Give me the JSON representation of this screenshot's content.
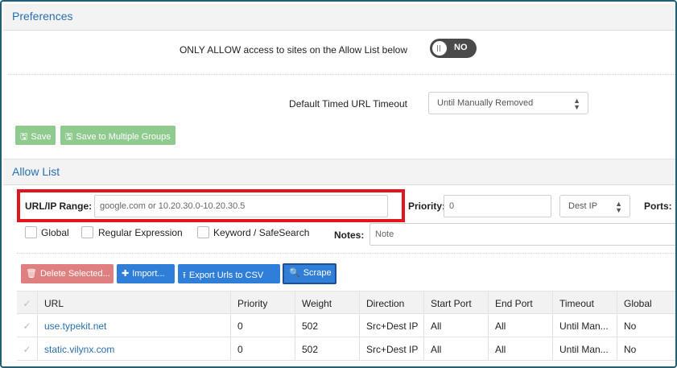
{
  "preferences": {
    "title": "Preferences",
    "only_allow_label": "ONLY ALLOW access to sites on the Allow List below",
    "toggle_text": "NO",
    "timeout_label": "Default Timed URL Timeout",
    "timeout_value": "Until Manually Removed",
    "save_label": "Save",
    "save_multi_label": "Save to Multiple Groups"
  },
  "allow_list": {
    "title": "Allow List",
    "url_label": "URL/IP Range:",
    "url_placeholder": "google.com or 10.20.30.0-10.20.30.5",
    "priority_label": "Priority:",
    "priority_value": "0",
    "direction_value": "Dest IP",
    "ports_label": "Ports:",
    "checkboxes": [
      "Global",
      "Regular Expression",
      "Keyword / SafeSearch"
    ],
    "notes_label": "Notes:",
    "notes_placeholder": "Note"
  },
  "toolbar": {
    "delete_label": "Delete Selected...",
    "import_label": "Import...",
    "export_label": "Export Urls to CSV",
    "scrape_label": "Scrape"
  },
  "table": {
    "columns": [
      "URL",
      "Priority",
      "Weight",
      "Direction",
      "Start Port",
      "End Port",
      "Timeout",
      "Global"
    ],
    "rows": [
      [
        "use.typekit.net",
        "0",
        "502",
        "Src+Dest IP",
        "All",
        "All",
        "Until Man...",
        "No"
      ],
      [
        "static.vilynx.com",
        "0",
        "502",
        "Src+Dest IP",
        "All",
        "All",
        "Until Man...",
        "No"
      ]
    ]
  },
  "colors": {
    "accent": "#2a6fb0",
    "highlight": "#e3141c",
    "save_green": "#8fcb8f",
    "delete_red": "#e07f7f",
    "button_blue": "#2f7ed8"
  },
  "icons": [
    "save-icon",
    "trash-icon",
    "plus-icon",
    "export-icon",
    "search-icon",
    "check-icon",
    "select-arrows-icon"
  ]
}
